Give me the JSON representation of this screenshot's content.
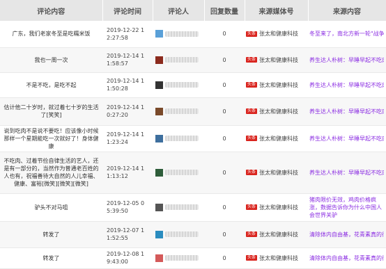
{
  "headers": [
    "评论内容",
    "评论时间",
    "评论人",
    "回复数量",
    "来源媒体号",
    "来源内容"
  ],
  "rows": [
    {
      "content": "广东，我们老家冬至是吃糯米饭",
      "time": "2019-12-22 1\n2:27:58",
      "avatar_color": "#5aa0d8",
      "replies": "0",
      "badge": "头条",
      "media": "张太和健康科技",
      "source": "冬至来了，南北方新一轮\"战争\"即将开"
    },
    {
      "content": "我也一周一次",
      "time": "2019-12-14 1\n1:58:57",
      "avatar_color": "#8b2a1d",
      "replies": "0",
      "badge": "头条",
      "media": "张太和健康科技",
      "source": "养生达人朴树：早睡早起不吃肉"
    },
    {
      "content": "不是不吃，是吃不起",
      "time": "2019-12-14 1\n1:50:28",
      "avatar_color": "#333333",
      "replies": "0",
      "badge": "头条",
      "media": "张太和健康科技",
      "source": "养生达人朴树：早睡早起不吃肉"
    },
    {
      "content": "估计他二十岁时，就过着七十岁的生活了[笑笑]",
      "time": "2019-12-14 1\n0:27:20",
      "avatar_color": "#7a4a2a",
      "replies": "0",
      "badge": "头条",
      "media": "张太和健康科技",
      "source": "养生达人朴树：早睡早起不吃肉"
    },
    {
      "content": "说到吃肉不是说不要吃！应该像小时候那样一个星期能吃一次就好了！身体健康",
      "time": "2019-12-14 1\n1:23:24",
      "avatar_color": "#3e6f9e",
      "replies": "0",
      "badge": "头条",
      "media": "张太和健康科技",
      "source": "养生达人朴树：早睡早起不吃肉"
    },
    {
      "content": "不吃肉、过着节俭自律生活的艺人，还是有一部分的，当然作为普通老百姓的人也有，祝福善待大自然的人儿幸福、健康、富裕[微笑][微笑][微笑]",
      "time": "2019-12-14 1\n1:13:12",
      "avatar_color": "#2e5d3a",
      "replies": "0",
      "badge": "头条",
      "media": "张太和健康科技",
      "source": "养生达人朴树：早睡早起不吃肉"
    },
    {
      "content": "驴头不对马咀",
      "time": "2019-12-05 0\n5:39:50",
      "avatar_color": "#555555",
      "replies": "0",
      "badge": "头条",
      "media": "张太和健康科技",
      "source": "猪肉限价无效，鸡肉价格疯涨，数据告诉你为什么中国人会世界关驴"
    },
    {
      "content": "转发了",
      "time": "2019-12-07 1\n1:52:55",
      "avatar_color": "#2a8cbf",
      "replies": "0",
      "badge": "头条",
      "media": "张太和健康科技",
      "source": "清除体内自由基，花青素真的很神奇"
    },
    {
      "content": "转发了",
      "time": "2019-12-08 1\n9:43:00",
      "avatar_color": "#d45a5a",
      "replies": "0",
      "badge": "头条",
      "media": "张太和健康科技",
      "source": "清除体内自由基，花青素真的很神奇"
    }
  ],
  "row_heights": [
    38,
    36,
    36,
    40,
    38,
    60,
    40,
    38,
    30
  ]
}
